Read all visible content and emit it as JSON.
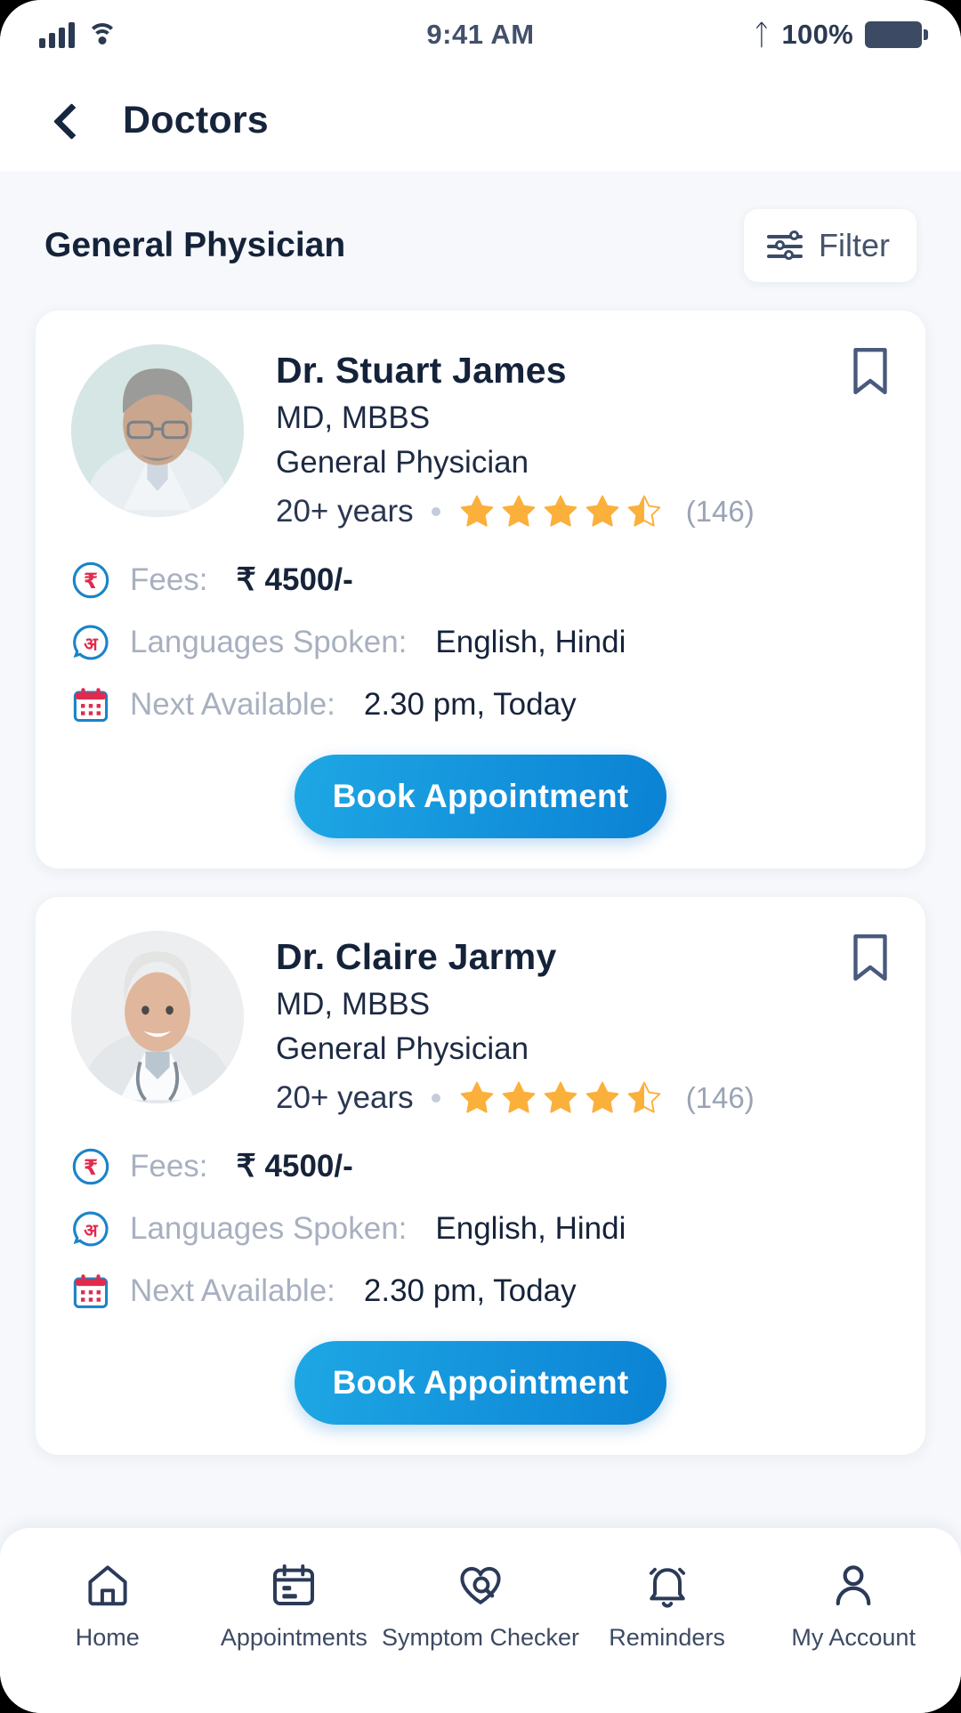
{
  "statusbar": {
    "time": "9:41 AM",
    "battery_percent": "100%",
    "signal_icon": "cellular-signal-icon",
    "wifi_icon": "wifi-icon",
    "bluetooth_icon": "bluetooth-icon",
    "battery_icon": "battery-icon"
  },
  "header": {
    "back_icon": "back-chevron-icon",
    "title": "Doctors"
  },
  "section": {
    "title": "General Physician",
    "filter_label": "Filter",
    "filter_icon": "sliders-icon"
  },
  "colors": {
    "accent_blue": "#0b82d4",
    "accent_blue_light": "#1ea7e4",
    "star_gold": "#fbb03b",
    "label_gray": "#a8b0c0",
    "text_dark": "#16233a"
  },
  "labels": {
    "fees": "Fees:",
    "languages": "Languages Spoken:",
    "next_available": "Next Available:",
    "book": "Book Appointment",
    "fees_icon": "rupee-coin-icon",
    "languages_icon": "language-speech-icon",
    "calendar_icon": "calendar-icon",
    "bookmark_icon": "bookmark-icon"
  },
  "doctors": [
    {
      "name": "Dr. Stuart James",
      "degree": "MD, MBBS",
      "specialty": "General Physician",
      "experience": "20+ years",
      "rating": 4.5,
      "reviews": "(146)",
      "fees": "₹ 4500/-",
      "languages": "English, Hindi",
      "next_available": "2.30 pm, Today",
      "avatar_tone": "mint"
    },
    {
      "name": "Dr. Claire Jarmy",
      "degree": "MD, MBBS",
      "specialty": "General Physician",
      "experience": "20+ years",
      "rating": 4.5,
      "reviews": "(146)",
      "fees": "₹ 4500/-",
      "languages": "English, Hindi",
      "next_available": "2.30 pm, Today",
      "avatar_tone": "gray"
    }
  ],
  "tabbar": [
    {
      "label": "Home",
      "icon": "home-icon"
    },
    {
      "label": "Appointments",
      "icon": "calendar-icon"
    },
    {
      "label": "Symptom Checker",
      "icon": "heart-search-icon"
    },
    {
      "label": "Reminders",
      "icon": "bell-icon"
    },
    {
      "label": "My Account",
      "icon": "user-icon"
    }
  ]
}
